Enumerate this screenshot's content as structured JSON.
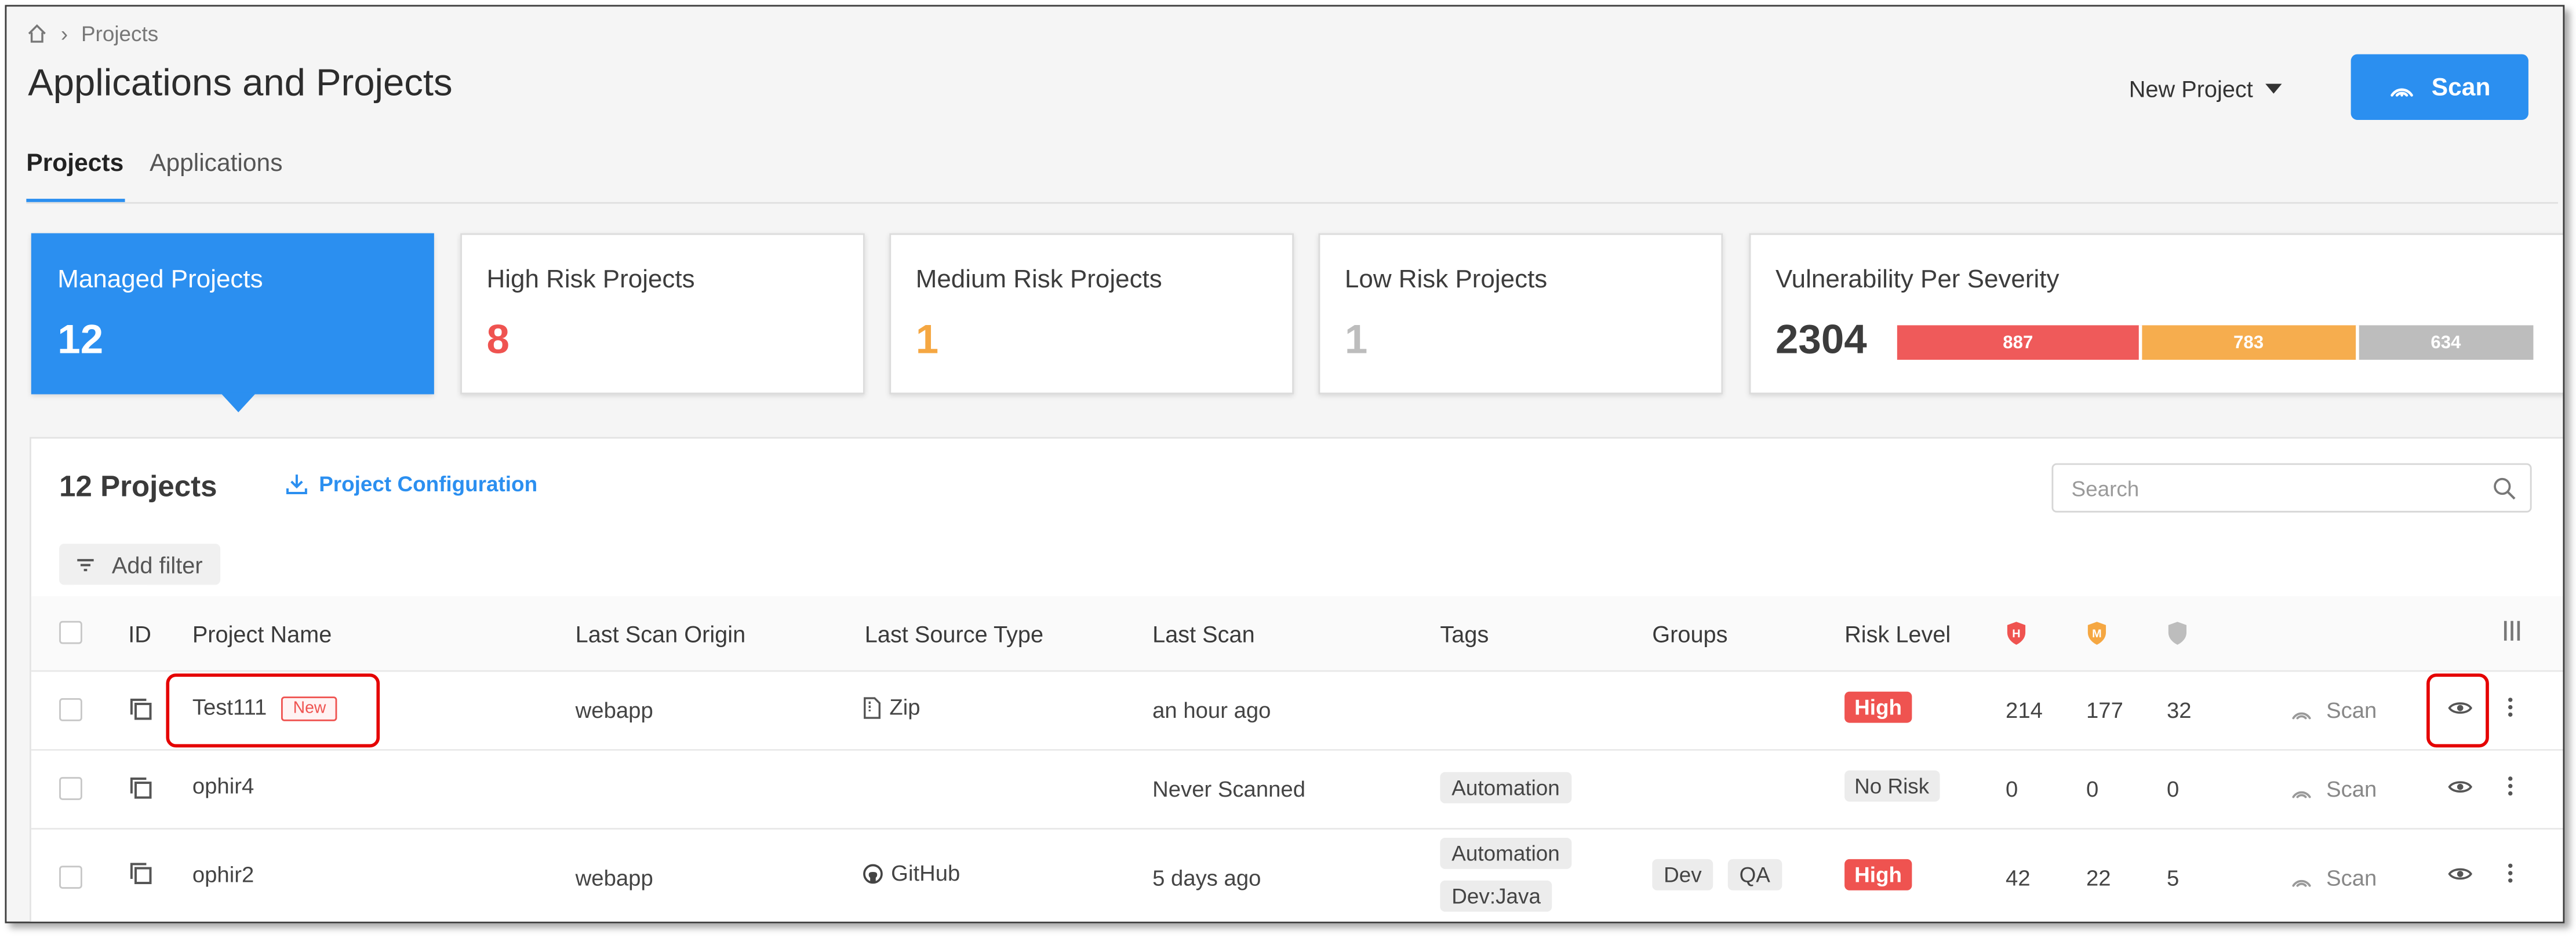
{
  "breadcrumb": {
    "home_icon": "home-icon",
    "separator": "›",
    "current": "Projects"
  },
  "header": {
    "title": "Applications and Projects",
    "new_project_label": "New Project",
    "scan_label": "Scan",
    "scan_icon": "radar-icon"
  },
  "tabs": [
    {
      "label": "Projects",
      "active": true
    },
    {
      "label": "Applications",
      "active": false
    }
  ],
  "cards": {
    "managed": {
      "label": "Managed Projects",
      "value": "12"
    },
    "high": {
      "label": "High Risk Projects",
      "value": "8",
      "color": "#ef5350"
    },
    "medium": {
      "label": "Medium Risk Projects",
      "value": "1",
      "color": "#f5a742"
    },
    "low": {
      "label": "Low Risk Projects",
      "value": "1",
      "color": "#bdbdbd"
    },
    "severity": {
      "label": "Vulnerability Per Severity",
      "total": "2304",
      "segments": [
        {
          "label": "887",
          "value": 887,
          "color": "#ef5a5a"
        },
        {
          "label": "783",
          "value": 783,
          "color": "#f6ad4e"
        },
        {
          "label": "634",
          "value": 634,
          "color": "#bdbdbd"
        }
      ]
    }
  },
  "panel": {
    "count_label": "12 Projects",
    "config_label": "Project Configuration",
    "search_placeholder": "Search",
    "add_filter_label": "Add filter"
  },
  "table": {
    "columns": {
      "id": "ID",
      "name": "Project Name",
      "origin": "Last Scan Origin",
      "source": "Last Source Type",
      "last_scan": "Last Scan",
      "tags": "Tags",
      "groups": "Groups",
      "risk": "Risk Level",
      "high_icon": "high-severity-shield-icon",
      "medium_icon": "medium-severity-shield-icon",
      "low_icon": "low-severity-shield-icon",
      "columns_icon": "column-settings-icon"
    },
    "rows": [
      {
        "name": "Test111",
        "badge": "New",
        "origin": "webapp",
        "source": "Zip",
        "source_icon": "zip-icon",
        "last_scan": "an hour ago",
        "tags": [],
        "groups": [],
        "risk": "High",
        "high": "214",
        "medium": "177",
        "low": "32",
        "scan_label": "Scan"
      },
      {
        "name": "ophir4",
        "badge": "",
        "origin": "",
        "source": "",
        "source_icon": "",
        "last_scan": "Never Scanned",
        "tags": [
          "Automation"
        ],
        "groups": [],
        "risk": "No Risk",
        "high": "0",
        "medium": "0",
        "low": "0",
        "scan_label": "Scan"
      },
      {
        "name": "ophir2",
        "badge": "",
        "origin": "webapp",
        "source": "GitHub",
        "source_icon": "github-icon",
        "last_scan": "5 days ago",
        "tags": [
          "Automation",
          "Dev:Java"
        ],
        "groups": [
          "Dev",
          "QA"
        ],
        "risk": "High",
        "high": "42",
        "medium": "22",
        "low": "5",
        "scan_label": "Scan"
      }
    ]
  },
  "colors": {
    "accent": "#2b8ff0",
    "high": "#ef5350",
    "medium": "#f5a742",
    "low": "#bdbdbd",
    "highlight": "#e50000"
  }
}
